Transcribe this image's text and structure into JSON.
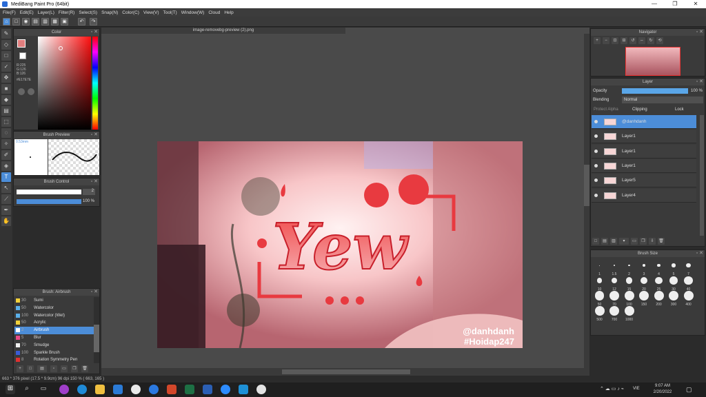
{
  "window": {
    "title": "MediBang Paint Pro (64bit)",
    "minimize": "—",
    "maximize": "❐",
    "close": "✕"
  },
  "menu": [
    "File(F)",
    "Edit(E)",
    "Layer(L)",
    "Filter(R)",
    "Select(S)",
    "Snap(N)",
    "Color(C)",
    "View(V)",
    "Tool(T)",
    "Window(W)",
    "Cloud",
    "Help"
  ],
  "panels": {
    "color": "Color",
    "brush_preview": "Brush Preview",
    "brush_control": "Brush Control",
    "brush_list": "Brush: Airbrush",
    "navigator": "Navigator",
    "layer": "Layer",
    "brush_size": "Brush Size"
  },
  "color": {
    "r": "R:225",
    "g": "G:126",
    "b": "B:126",
    "hex": "#E17E7E",
    "current": "#e17e7e"
  },
  "brush_preview": {
    "size": "0.53mm"
  },
  "brush_control": {
    "size": "2",
    "opacity": "100 %"
  },
  "brushes": [
    {
      "size": "30",
      "name": "Sumi",
      "color": "#f2d13a"
    },
    {
      "size": "50",
      "name": "Watercolor",
      "color": "#5ab0ea"
    },
    {
      "size": "100",
      "name": "Watercolor (Wet)",
      "color": "#5ab0ea"
    },
    {
      "size": "50",
      "name": "Acrylic",
      "color": "#f2d13a"
    },
    {
      "size": "2",
      "name": "Airbrush",
      "color": "#ffffff",
      "selected": true
    },
    {
      "size": "5",
      "name": "Blur",
      "color": "#e94b8a"
    },
    {
      "size": "70",
      "name": "Smudge",
      "color": "#f0f0f0"
    },
    {
      "size": "100",
      "name": "Sparkle Brush",
      "color": "#3a5bd6"
    },
    {
      "size": "8",
      "name": "Rotation Symmetry Pen",
      "color": "#e03030"
    }
  ],
  "document": {
    "tab": "image-removebg-preview (2).png"
  },
  "artwork": {
    "word": "Yew",
    "credit1": "@danhdanh",
    "credit2": "#Hoidap247"
  },
  "layer": {
    "opacity_label": "Opacity",
    "opacity_value": "100 %",
    "blending_label": "Blending",
    "blending_value": "Normal",
    "protect_alpha": "Protect Alpha",
    "clipping": "Clipping",
    "lock": "Lock",
    "layers": [
      {
        "name": "@danhdanh",
        "selected": true
      },
      {
        "name": "Layer1"
      },
      {
        "name": "Layer1"
      },
      {
        "name": "Layer1"
      },
      {
        "name": "Layer5"
      },
      {
        "name": "Layer4"
      }
    ]
  },
  "brush_sizes": [
    "1",
    "1.5",
    "2",
    "3",
    "4",
    "5",
    "7",
    "10",
    "12",
    "15",
    "20",
    "25",
    "30",
    "40",
    "50",
    "70",
    "100",
    "150",
    "200",
    "300",
    "400",
    "500",
    "700",
    "1000"
  ],
  "status": {
    "text": "663 * 376 pixel   (17.5 * 9.9cm)   96 dpi   150 %   ( 663, 165 )"
  },
  "taskbar": {
    "time": "9:07 AM",
    "date": "2/20/2022",
    "lang": "VIE"
  }
}
